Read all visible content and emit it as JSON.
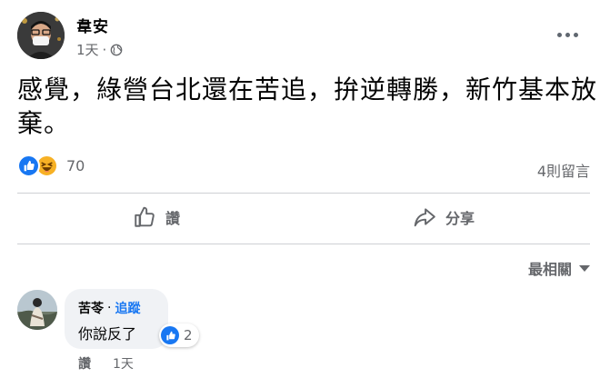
{
  "post": {
    "author": "韋安",
    "time": "1天",
    "separator": "·",
    "text": "感覺，綠營台北還在苦追，拚逆轉勝，新竹基本放棄。",
    "reaction_count": "70",
    "comment_count": "4則留言"
  },
  "actions": {
    "like_label": "讚",
    "share_label": "分享"
  },
  "sort": {
    "label": "最相關"
  },
  "comment": {
    "author": "苦苓",
    "separator": "·",
    "follow_label": "追蹤",
    "text": "你說反了",
    "reaction_count": "2",
    "like_label": "讚",
    "time": "1天"
  },
  "colors": {
    "accent": "#1877f2",
    "secondary_text": "#65676b",
    "bubble_bg": "#f0f2f5",
    "haha": "#f7b125"
  }
}
